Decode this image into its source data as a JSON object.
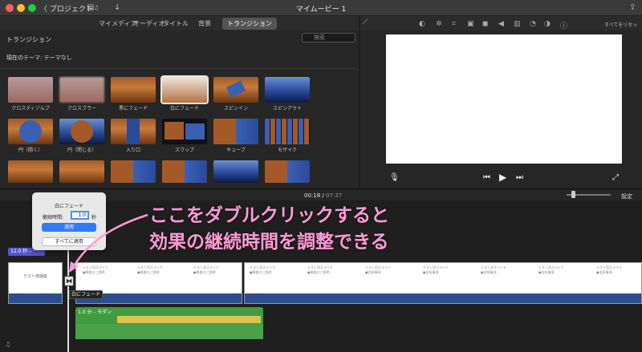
{
  "titlebar": {
    "back_label": "〈 プロジェクト",
    "window_title": "マイムービー 1"
  },
  "tabs": {
    "media": "マイメディア",
    "audio": "オーディオ",
    "titles": "タイトル",
    "background": "背景",
    "transitions": "トランジション"
  },
  "browser": {
    "title": "トランジション",
    "search_placeholder": "検索",
    "theme_label": "現在のテーマ: テーマなし",
    "thumbnails": [
      {
        "label": "クロスディゾルブ"
      },
      {
        "label": "クロスブラー"
      },
      {
        "label": "黒にフェード"
      },
      {
        "label": "白にフェード"
      },
      {
        "label": "スピンイン"
      },
      {
        "label": "スピンアウト"
      },
      {
        "label": "円（開く）"
      },
      {
        "label": "円（閉じる）"
      },
      {
        "label": "入り口"
      },
      {
        "label": "スワップ"
      },
      {
        "label": "キューブ"
      },
      {
        "label": "モザイク"
      }
    ]
  },
  "viewer": {
    "reset_label": "すべてをリセット"
  },
  "timeline": {
    "timecode": "00:18",
    "total": "07:37",
    "settings_label": "設定",
    "title_clip_label": "12.0 秒 – ",
    "audio_label": "1.0 分 – モダン",
    "title_clip_text": "テスト用講座"
  },
  "popup": {
    "title": "白にフェード",
    "duration_label": "継続時間:",
    "duration_value": "1.0",
    "duration_unit": "秒",
    "apply": "適用",
    "apply_all": "すべてに適用"
  },
  "tooltip": "白にフェード",
  "annotation": {
    "line1": "ここをダブルクリックすると",
    "line2": "効果の継続時間を調整できる",
    "color": "#ff9ad6"
  },
  "clip_texts": {
    "t1": "テスト用スライド",
    "t2": "●概要のご説明",
    "t3": "●告知事項"
  }
}
